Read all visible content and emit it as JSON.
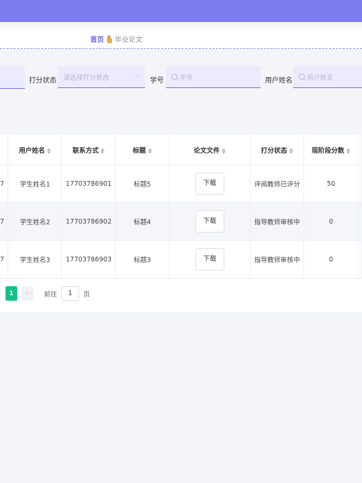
{
  "breadcrumb": {
    "home": "首页",
    "current": "毕业论文"
  },
  "filters": {
    "status_label": "打分状态",
    "status_placeholder": "请选择打分状态",
    "student_no_label": "学号",
    "student_no_placeholder": "学号",
    "username_label": "用户姓名",
    "username_placeholder": "用户姓名"
  },
  "table": {
    "columns": [
      "用户姓名",
      "联系方式",
      "标题",
      "论文文件",
      "打分状态",
      "现阶段分数"
    ],
    "rows": [
      {
        "prefix": "7",
        "name": "学生姓名1",
        "phone": "17703786901",
        "title": "标题5",
        "file": "下载",
        "status": "评阅教师已评分",
        "score": "50"
      },
      {
        "prefix": "7",
        "name": "学生姓名2",
        "phone": "17703786902",
        "title": "标题4",
        "file": "下载",
        "status": "指导教师审核中",
        "score": "0"
      },
      {
        "prefix": "7",
        "name": "学生姓名3",
        "phone": "17703786903",
        "title": "标题3",
        "file": "下载",
        "status": "指导教师审核中",
        "score": "0"
      }
    ]
  },
  "pagination": {
    "current_page": "1",
    "goto_prefix": "前往",
    "goto_value": "1",
    "goto_suffix": "页"
  }
}
